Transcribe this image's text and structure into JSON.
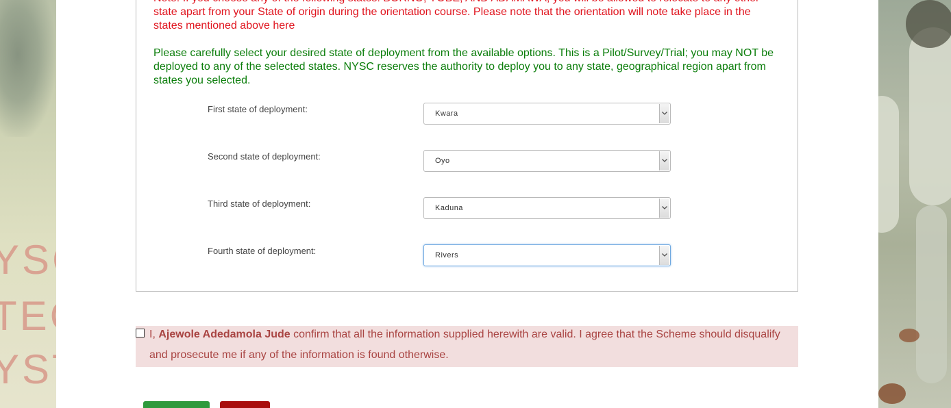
{
  "notes": {
    "red_note": "Note: If you choose any of the following states: BORNO, YOBE, AND ADAMAWA, you will be allowed to relocate to any other state apart from your State of origin during the orientation course. Please note that the orientation will note take place in the states mentioned above here",
    "green_note": " Please carefully select your desired state of deployment from the available options. This is a Pilot/Survey/Trial; you may NOT be deployed to any of the selected states. NYSC reserves the authority to deploy you to any state, geographical region apart from states you selected."
  },
  "deployment": {
    "first": {
      "label": "First state of deployment:",
      "value": "Kwara"
    },
    "second": {
      "label": "Second state of deployment:",
      "value": "Oyo"
    },
    "third": {
      "label": "Third state of deployment:",
      "value": "Kaduna"
    },
    "fourth": {
      "label": "Fourth state of deployment:",
      "value": "Rivers"
    }
  },
  "confirmation": {
    "prefix": "I, ",
    "name": "Ajewole Adedamola Jude",
    "suffix": " confirm that all the information supplied herewith are valid. I agree that the Scheme should disqualify and prosecute me if any of the information is found otherwise.",
    "checked": false
  },
  "background": {
    "left_letters": [
      "YSC",
      "TEC",
      "YST"
    ]
  },
  "colors": {
    "note_red": "#e0141e",
    "note_green": "#0a7d0a",
    "confirm_bg": "#f2dede",
    "confirm_text": "#a94442",
    "submit_green": "#2e9a3c",
    "cancel_red": "#a90d0d"
  }
}
